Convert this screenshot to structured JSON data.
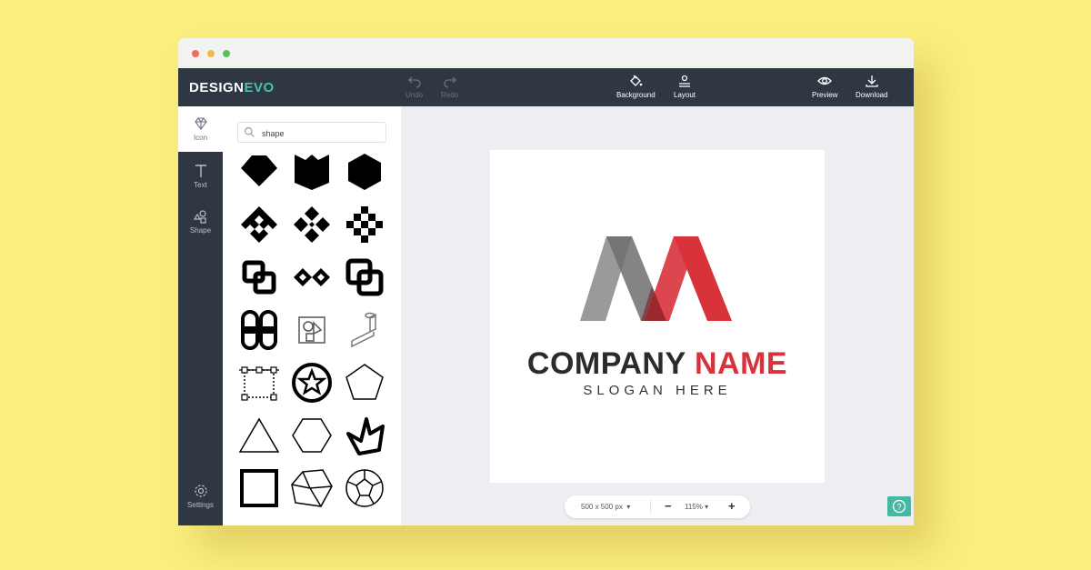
{
  "app": {
    "logo_part1": "DESIGN",
    "logo_part2": "EVO",
    "accent_color": "#49c1b2"
  },
  "toolbar": {
    "undo": "Undo",
    "redo": "Redo",
    "background": "Background",
    "layout": "Layout",
    "preview": "Preview",
    "download": "Download"
  },
  "sidebar": {
    "items": [
      {
        "label": "Icon",
        "icon": "diamond-icon"
      },
      {
        "label": "Text",
        "icon": "text-t-icon"
      },
      {
        "label": "Shape",
        "icon": "shapes-icon"
      }
    ],
    "settings": "Settings"
  },
  "search": {
    "value": "shape",
    "placeholder": ""
  },
  "icon_grid": [
    "diamond-shape",
    "shield-shape",
    "hexagon-shape",
    "checker-diamond",
    "four-diamonds",
    "pixel-diamond",
    "overlap-squares",
    "diamond-chain",
    "double-square",
    "clover-shape",
    "shapes-square",
    "isometric-shape",
    "bezier-square",
    "circle-star",
    "pentagon-outline",
    "triangle-outline",
    "hexagon-outline",
    "crown-outline",
    "square-outline",
    "polyhedron",
    "dodecahedron"
  ],
  "canvas": {
    "company_1": "COMPANY",
    "company_2": "NAME",
    "slogan": "SLOGAN HERE",
    "brand_red": "#d8323b",
    "brand_gray": "#8a8a8a"
  },
  "bottom": {
    "size": "500 x 500 px",
    "zoom": "115%",
    "minus": "−",
    "plus": "+",
    "help": "?"
  }
}
